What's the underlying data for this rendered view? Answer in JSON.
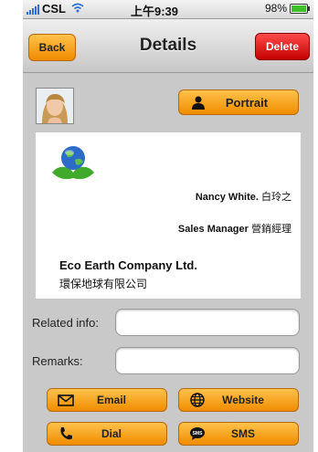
{
  "status_bar": {
    "carrier": "CSL",
    "time": "上午9:39",
    "battery": "98%",
    "battery_level": 0.98
  },
  "nav": {
    "back_label": "Back",
    "title": "Details",
    "delete_label": "Delete"
  },
  "portrait_button": "Portrait",
  "card": {
    "name": "Nancy White.",
    "name_cjk": "白玲之",
    "title": "Sales Manager",
    "title_cjk": "營銷經理",
    "company": "Eco Earth Company Ltd.",
    "company_cjk": "環保地球有限公司"
  },
  "fields": {
    "related_label": "Related info:",
    "related_value": "",
    "remarks_label": "Remarks:",
    "remarks_value": ""
  },
  "actions": {
    "email": "Email",
    "website": "Website",
    "dial": "Dial",
    "sms": "SMS"
  },
  "icons": {
    "signal": "signal-bars-icon",
    "wifi": "wifi-icon",
    "battery": "battery-icon",
    "portrait": "person-icon",
    "email": "envelope-icon",
    "website": "globe-icon",
    "dial": "phone-handset-icon",
    "sms": "sms-bubble-icon"
  },
  "colors": {
    "button_orange": "#f5a01a",
    "delete_red": "#e00000",
    "background": "#c9c9c9"
  }
}
